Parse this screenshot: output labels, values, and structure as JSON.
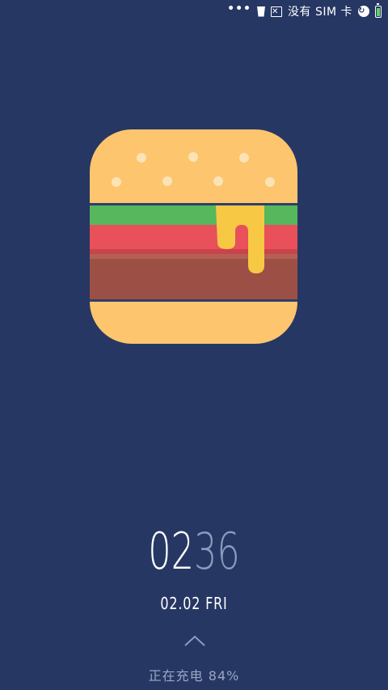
{
  "status_bar": {
    "more_indicator": "•••",
    "sim_status": "没有 SIM 卡",
    "notification_box_glyph": "✕",
    "battery_level": 0.84,
    "icons": [
      "more-dots-icon",
      "cup-icon",
      "x-box-icon",
      "globe-icon",
      "battery-icon"
    ]
  },
  "lockscreen": {
    "wallpaper_icon": "hamburger-icon",
    "time_hours": "02",
    "time_minutes": "36",
    "date": "02.02 FRI",
    "charging_text": "正在充电 84%",
    "colors": {
      "background": "#263763",
      "minutes": "#8c9bbd",
      "bun": "#fcc56e",
      "lettuce": "#57b75d",
      "tomato": "#e8505a",
      "patty": "#9c5045",
      "cheese": "#f7c844"
    }
  }
}
